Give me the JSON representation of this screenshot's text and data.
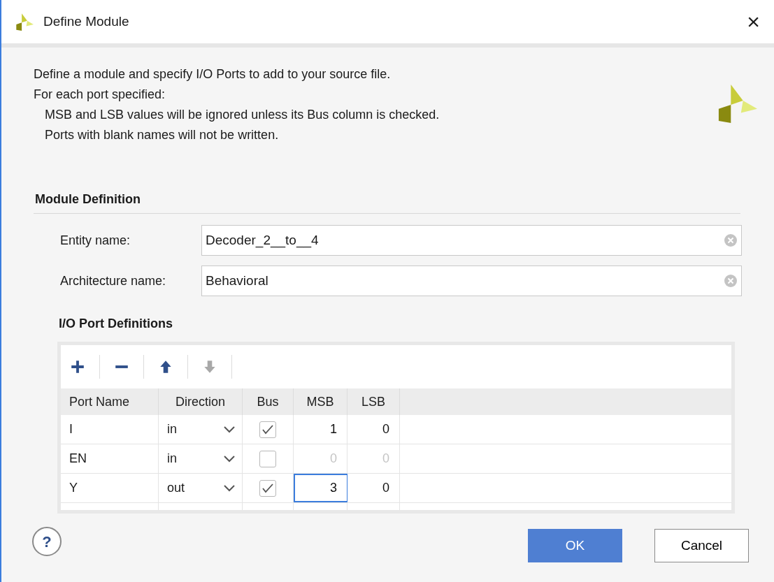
{
  "window": {
    "title": "Define Module",
    "close": "×"
  },
  "intro": [
    "Define a module and specify I/O Ports to add to your source file.",
    "For each port specified:"
  ],
  "notes": [
    "MSB and LSB values will be ignored unless its Bus column is checked.",
    "Ports with blank names will not be written."
  ],
  "module_definition": {
    "heading": "Module Definition",
    "fields": [
      {
        "label": "Entity name:",
        "value": "Decoder_2__to__4"
      },
      {
        "label": "Architecture name:",
        "value": "Behavioral"
      }
    ]
  },
  "ports": {
    "heading": "I/O Port Definitions",
    "toolbar": [
      {
        "kind": "add",
        "disabled": false
      },
      {
        "kind": "remove",
        "disabled": false
      },
      {
        "kind": "up",
        "disabled": false
      },
      {
        "kind": "down",
        "disabled": true
      }
    ],
    "columns": [
      "Port Name",
      "Direction",
      "Bus",
      "MSB",
      "LSB"
    ],
    "rows": [
      {
        "name": "I",
        "direction": "in",
        "bus": true,
        "msb": "1",
        "lsb": "0",
        "msb_focused": false
      },
      {
        "name": "EN",
        "direction": "in",
        "bus": false,
        "msb": "0",
        "lsb": "0",
        "msb_focused": false
      },
      {
        "name": "Y",
        "direction": "out",
        "bus": true,
        "msb": "3",
        "lsb": "0",
        "msb_focused": true
      }
    ]
  },
  "help": "?",
  "buttons": [
    {
      "label": "OK",
      "primary": true
    },
    {
      "label": "Cancel",
      "primary": false
    }
  ]
}
